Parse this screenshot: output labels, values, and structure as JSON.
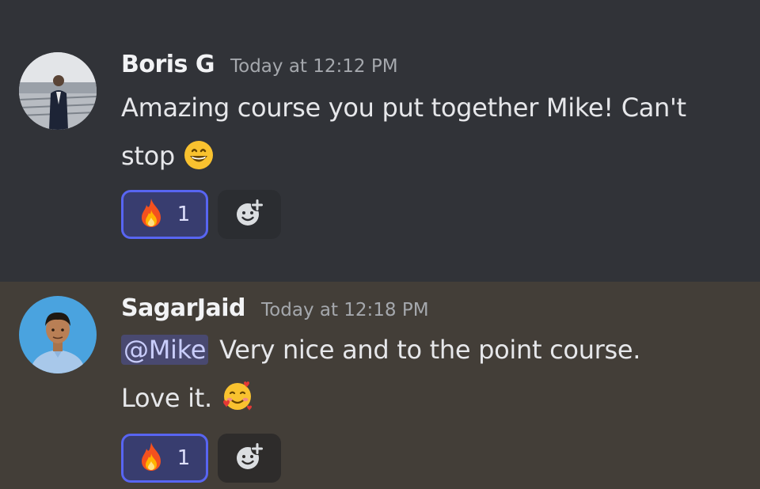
{
  "messages": [
    {
      "username": "Boris G",
      "timestamp": "Today at 12:12 PM",
      "lines": [
        "Amazing course you put together Mike! Can't",
        "stop"
      ],
      "inline_emoji": "grinning-face-with-smiling-eyes",
      "reactions": [
        {
          "emoji": "fire",
          "count": "1",
          "active": true
        }
      ]
    },
    {
      "username": "SagarJaid",
      "timestamp": "Today at 12:18 PM",
      "mention": "@Mike",
      "lines": [
        "Very nice and to the point course.",
        "Love it."
      ],
      "inline_emoji": "smiling-face-with-hearts",
      "reactions": [
        {
          "emoji": "fire",
          "count": "1",
          "active": true
        }
      ]
    }
  ],
  "colors": {
    "background": "#313338",
    "highlighted_message_background": "#433e38",
    "reaction_border": "#5865f2",
    "reaction_background": "#383d6f",
    "mention_background": "#3c4270"
  },
  "icons": {
    "add_reaction": "add-reaction-icon",
    "fire": "fire-emoji"
  }
}
